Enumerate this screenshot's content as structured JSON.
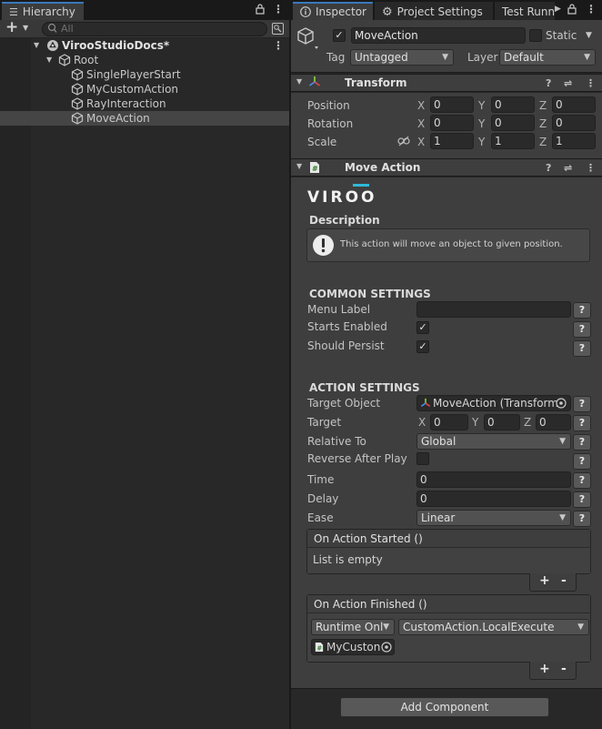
{
  "hierarchy": {
    "tab_label": "Hierarchy",
    "search_placeholder": "All",
    "scene": "VirooStudioDocs*",
    "root": "Root",
    "items": [
      "SinglePlayerStart",
      "MyCustomAction",
      "RayInteraction",
      "MoveAction"
    ],
    "selected_item": "MoveAction"
  },
  "inspector_tabs": {
    "inspector": "Inspector",
    "project_settings": "Project Settings",
    "test_runner": "Test Runn"
  },
  "object": {
    "active": true,
    "name": "MoveAction",
    "static_label": "Static",
    "static": false,
    "tag_label": "Tag",
    "tag": "Untagged",
    "layer_label": "Layer",
    "layer": "Default"
  },
  "transform": {
    "title": "Transform",
    "position_label": "Position",
    "rotation_label": "Rotation",
    "scale_label": "Scale",
    "axes": [
      "X",
      "Y",
      "Z"
    ],
    "position": [
      "0",
      "0",
      "0"
    ],
    "rotation": [
      "0",
      "0",
      "0"
    ],
    "scale": [
      "1",
      "1",
      "1"
    ]
  },
  "move_action": {
    "title": "Move Action",
    "logo": "VIROO",
    "description_heading": "Description",
    "description": "This action will move an object to given position.",
    "common_heading": "COMMON SETTINGS",
    "menu_label_label": "Menu Label",
    "menu_label_value": "",
    "starts_enabled_label": "Starts Enabled",
    "starts_enabled": true,
    "should_persist_label": "Should Persist",
    "should_persist": true,
    "action_heading": "ACTION SETTINGS",
    "target_object_label": "Target Object",
    "target_object_value": "MoveAction (Transform",
    "target_label": "Target",
    "target": [
      "0",
      "0",
      "0"
    ],
    "relative_to_label": "Relative To",
    "relative_to": "Global",
    "reverse_after_play_label": "Reverse After Play",
    "reverse_after_play": false,
    "time_label": "Time",
    "time": "0",
    "delay_label": "Delay",
    "delay": "0",
    "ease_label": "Ease",
    "ease": "Linear",
    "help_symbol": "?",
    "on_started": {
      "title": "On Action Started ()",
      "empty_text": "List is empty"
    },
    "on_finished": {
      "title": "On Action Finished ()",
      "mode": "Runtime Only",
      "function": "CustomAction.LocalExecute",
      "object": "MyCuston"
    },
    "plus": "+",
    "minus": "-"
  },
  "add_component_label": "Add Component",
  "colors": {
    "accent": "#3a79bb",
    "panel": "#282828",
    "header": "#3e3e3e",
    "viroo_cyan": "#2fb8d8"
  }
}
